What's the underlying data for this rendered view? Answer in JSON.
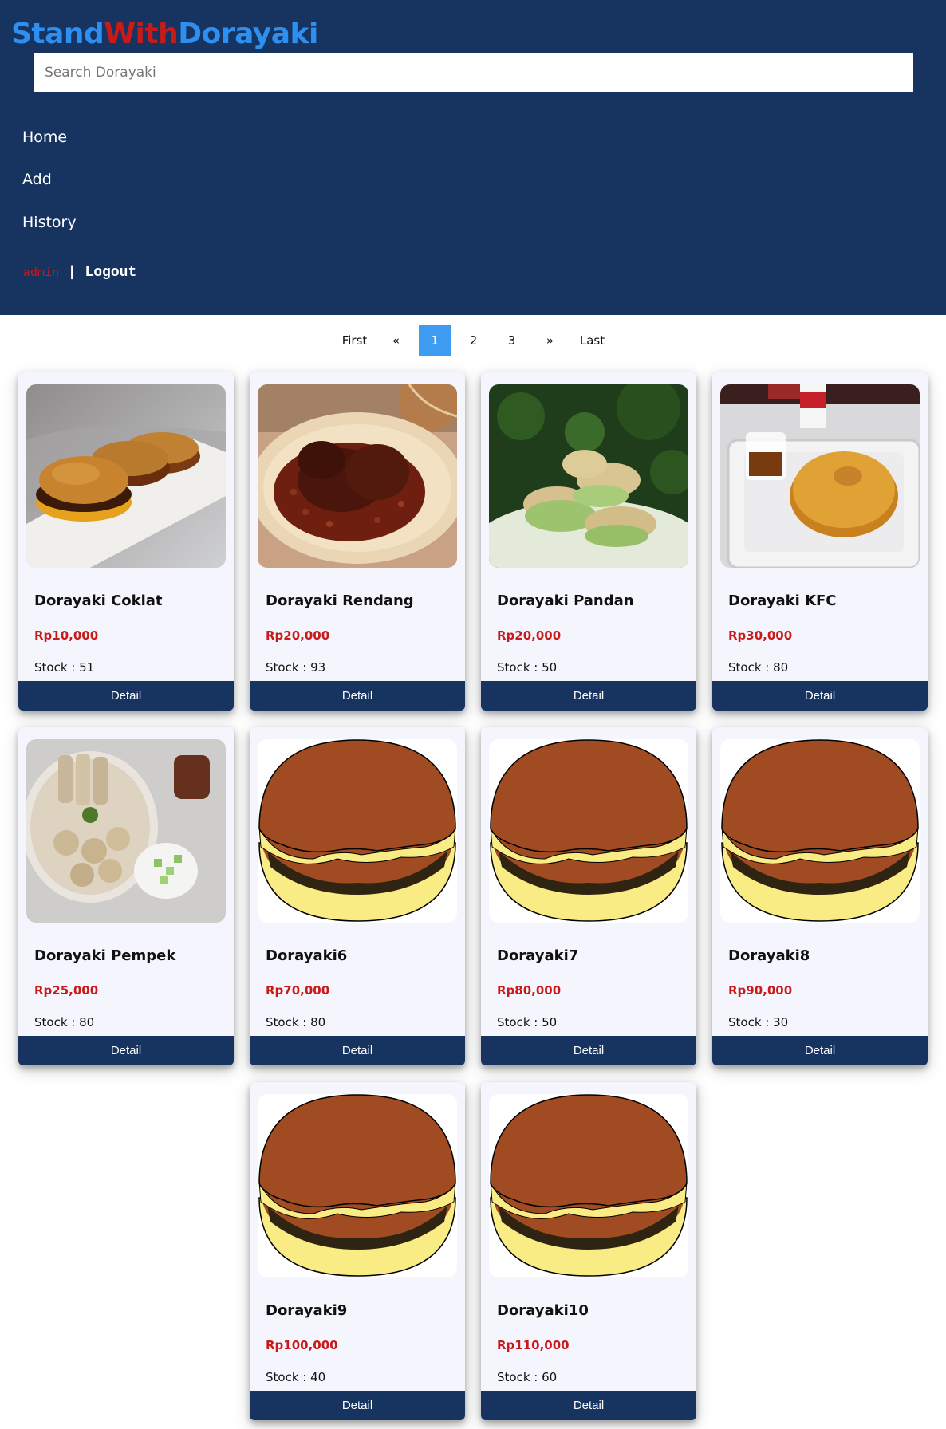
{
  "header": {
    "logo": {
      "part1": "Stand",
      "part2": "With",
      "part3": "Dorayaki"
    },
    "search_placeholder": "Search Dorayaki",
    "search_value": "",
    "nav": [
      {
        "label": "Home"
      },
      {
        "label": "Add"
      },
      {
        "label": "History"
      }
    ],
    "user": {
      "username": "admin",
      "separator": "|",
      "logout_label": "Logout"
    }
  },
  "pagination": {
    "first": "First",
    "prev": "«",
    "pages": [
      "1",
      "2",
      "3"
    ],
    "current_page": "1",
    "next": "»",
    "last": "Last"
  },
  "products": [
    {
      "name": "Dorayaki Coklat",
      "price": "Rp10,000",
      "stock": "Stock : 51",
      "image": "chocolate-dorayaki-photo",
      "button": "Detail"
    },
    {
      "name": "Dorayaki Rendang",
      "price": "Rp20,000",
      "stock": "Stock : 93",
      "image": "rendang-photo",
      "button": "Detail"
    },
    {
      "name": "Dorayaki Pandan",
      "price": "Rp20,000",
      "stock": "Stock : 50",
      "image": "pandan-dorayaki-photo",
      "button": "Detail"
    },
    {
      "name": "Dorayaki KFC",
      "price": "Rp30,000",
      "stock": "Stock : 80",
      "image": "kfc-pancake-photo",
      "button": "Detail"
    },
    {
      "name": "Dorayaki Pempek",
      "price": "Rp25,000",
      "stock": "Stock : 80",
      "image": "pempek-photo",
      "button": "Detail"
    },
    {
      "name": "Dorayaki6",
      "price": "Rp70,000",
      "stock": "Stock : 80",
      "image": "dorayaki-illustration",
      "button": "Detail"
    },
    {
      "name": "Dorayaki7",
      "price": "Rp80,000",
      "stock": "Stock : 50",
      "image": "dorayaki-illustration",
      "button": "Detail"
    },
    {
      "name": "Dorayaki8",
      "price": "Rp90,000",
      "stock": "Stock : 30",
      "image": "dorayaki-illustration",
      "button": "Detail"
    },
    {
      "name": "Dorayaki9",
      "price": "Rp100,000",
      "stock": "Stock : 40",
      "image": "dorayaki-illustration",
      "button": "Detail"
    },
    {
      "name": "Dorayaki10",
      "price": "Rp110,000",
      "stock": "Stock : 60",
      "image": "dorayaki-illustration",
      "button": "Detail"
    }
  ],
  "colors": {
    "header_bg": "#173360",
    "logo_blue": "#2d8ff0",
    "logo_red": "#c91a1a",
    "price_red": "#c91a1a",
    "active_page": "#3d9bf2",
    "card_bg": "#f5f6fd",
    "button_bg": "#173360"
  }
}
